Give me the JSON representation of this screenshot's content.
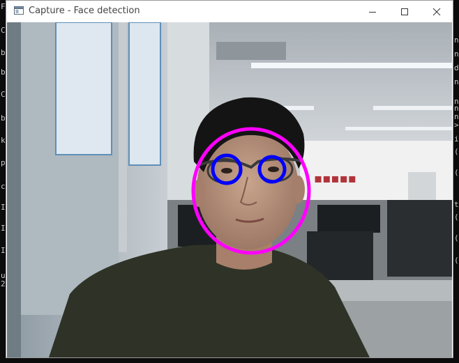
{
  "window": {
    "title": "Capture - Face detection",
    "icon": "app-window-icon",
    "controls": [
      "minimize-icon",
      "maximize-icon",
      "close-icon"
    ]
  },
  "terminal_left": [
    "F",
    "C",
    "b",
    "b",
    "C",
    "b",
    "k",
    "p",
    "c",
    "I",
    "I",
    "I",
    "u",
    "2"
  ],
  "terminal_right": [
    "n",
    "n",
    "d",
    "n",
    "n",
    "n",
    "n",
    ">",
    "i",
    "(",
    "(",
    "t",
    "(",
    "(",
    "("
  ],
  "detection": {
    "face_color": "#ff00ff",
    "eye_color": "#0000ff"
  }
}
